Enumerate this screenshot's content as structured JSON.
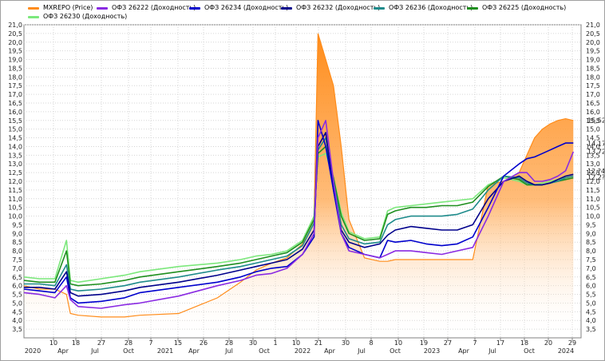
{
  "chart_data": {
    "type": "line",
    "ylim": [
      3.0,
      21.0
    ],
    "y_ticks": [
      "21,0",
      "20,5",
      "20,0",
      "19,5",
      "19,0",
      "18,5",
      "18,0",
      "17,5",
      "17,0",
      "16,5",
      "16,0",
      "15,5",
      "15,0",
      "14,5",
      "14,0",
      "13,5",
      "13,0",
      "12,5",
      "12,0",
      "11,5",
      "11,0",
      "10,5",
      "10,0",
      "9,5",
      "9,0",
      "8,5",
      "8,0",
      "7,5",
      "7,0",
      "6,5",
      "6,0",
      "5,5",
      "5,0",
      "4,5",
      "4,0",
      "3,5"
    ],
    "x_day_ticks": [
      "10",
      "18",
      "27",
      "28",
      "7",
      "15",
      "26",
      "28",
      "30",
      "1",
      "10",
      "21",
      "30",
      "8",
      "10",
      "19",
      "27",
      "7",
      "17",
      "18",
      "20",
      "29"
    ],
    "x_month_ticks": [
      "2020",
      "Apr",
      "Jul",
      "Oct",
      "2021",
      "Apr",
      "Jul",
      "Oct",
      "2022",
      "Apr",
      "Jul",
      "Oct",
      "2023",
      "Apr",
      "Jul",
      "Oct",
      "2024"
    ],
    "x": [
      0,
      20,
      40,
      55,
      60,
      70,
      100,
      130,
      150,
      200,
      250,
      280,
      300,
      320,
      340,
      360,
      375,
      380,
      390,
      400,
      410,
      420,
      440,
      460,
      470,
      480,
      500,
      520,
      540,
      560,
      580,
      600,
      620,
      640,
      650,
      660,
      670,
      680,
      690,
      700,
      710
    ],
    "grid": true,
    "last_value_labels": [
      "15,52",
      "14,17",
      "13,72",
      "12,?4",
      "12,2?"
    ],
    "series": [
      {
        "name": "MXREPO (Price)",
        "color": "#ff8c1a",
        "values": [
          6.0,
          5.8,
          5.8,
          5.5,
          4.4,
          4.3,
          4.2,
          4.2,
          4.3,
          4.4,
          5.3,
          6.2,
          6.9,
          7.3,
          7.6,
          8.4,
          10.0,
          20.5,
          19.0,
          17.5,
          14.0,
          9.8,
          7.6,
          7.4,
          7.4,
          7.5,
          7.5,
          7.5,
          7.5,
          7.5,
          7.5,
          11.8,
          12.0,
          12.5,
          13.5,
          14.5,
          15.0,
          15.3,
          15.5,
          15.6,
          15.5
        ]
      },
      {
        "name": "ОФЗ 26222 (Доходность)",
        "color": "#8a2be2",
        "values": [
          5.6,
          5.5,
          5.3,
          6.0,
          5.2,
          4.8,
          4.7,
          4.9,
          5.0,
          5.4,
          6.0,
          6.3,
          6.6,
          6.7,
          7.0,
          7.8,
          9.0,
          14.5,
          15.5,
          12.0,
          9.0,
          8.0,
          7.8,
          7.6,
          7.8,
          8.0,
          8.0,
          7.9,
          7.8,
          8.0,
          8.2,
          10.0,
          12.0,
          12.5,
          12.5,
          12.0,
          12.0,
          12.1,
          12.3,
          12.6,
          13.7
        ]
      },
      {
        "name": "ОФЗ 26234 (Доходность)",
        "color": "#0000cd",
        "values": [
          5.8,
          5.7,
          5.6,
          6.5,
          5.3,
          5.0,
          5.1,
          5.3,
          5.6,
          5.9,
          6.2,
          6.5,
          6.8,
          7.0,
          7.1,
          7.8,
          8.8,
          15.5,
          14.0,
          11.5,
          9.0,
          8.2,
          7.8,
          7.6,
          8.6,
          8.5,
          8.6,
          8.4,
          8.3,
          8.4,
          8.8,
          10.5,
          12.3,
          13.0,
          13.3,
          13.4,
          13.6,
          13.8,
          14.0,
          14.2,
          14.2
        ]
      },
      {
        "name": "ОФЗ 26232 (Доходность)",
        "color": "#00008b",
        "values": [
          5.9,
          5.9,
          5.8,
          6.8,
          5.6,
          5.4,
          5.5,
          5.7,
          5.9,
          6.2,
          6.6,
          6.9,
          7.1,
          7.3,
          7.5,
          8.1,
          9.2,
          14.0,
          14.8,
          11.5,
          9.2,
          8.5,
          8.2,
          8.4,
          8.9,
          9.2,
          9.4,
          9.3,
          9.2,
          9.2,
          9.5,
          11.0,
          12.0,
          12.3,
          12.0,
          11.8,
          11.8,
          11.9,
          12.1,
          12.3,
          12.4
        ]
      },
      {
        "name": "ОФЗ 26236 (Доходность)",
        "color": "#1e8b8b",
        "values": [
          6.1,
          6.1,
          6.0,
          7.2,
          5.8,
          5.7,
          5.8,
          6.0,
          6.2,
          6.5,
          6.9,
          7.1,
          7.3,
          7.5,
          7.7,
          8.3,
          9.6,
          13.8,
          14.5,
          12.0,
          9.5,
          8.7,
          8.4,
          8.5,
          9.5,
          9.8,
          10.0,
          10.0,
          10.0,
          10.1,
          10.4,
          11.5,
          12.3,
          12.2,
          11.9,
          11.8,
          11.8,
          11.9,
          12.0,
          12.2,
          12.3
        ]
      },
      {
        "name": "ОФЗ 26225 (Доходность)",
        "color": "#1f8f1f",
        "values": [
          6.3,
          6.2,
          6.2,
          8.0,
          6.1,
          6.0,
          6.1,
          6.3,
          6.5,
          6.8,
          7.1,
          7.3,
          7.5,
          7.7,
          7.9,
          8.5,
          9.8,
          13.6,
          14.0,
          12.2,
          10.0,
          9.0,
          8.6,
          8.7,
          10.1,
          10.3,
          10.5,
          10.5,
          10.6,
          10.6,
          10.8,
          11.7,
          12.3,
          12.1,
          11.8,
          11.8,
          11.8,
          11.9,
          12.0,
          12.1,
          12.2
        ]
      },
      {
        "name": "ОФЗ 26230 (Доходность)",
        "color": "#7ce87c",
        "values": [
          6.5,
          6.4,
          6.4,
          8.6,
          6.3,
          6.2,
          6.4,
          6.6,
          6.8,
          7.1,
          7.3,
          7.5,
          7.7,
          7.8,
          8.0,
          8.6,
          10.0,
          13.4,
          13.6,
          12.2,
          10.2,
          9.1,
          8.7,
          8.8,
          10.3,
          10.5,
          10.6,
          10.7,
          10.8,
          10.9,
          11.0,
          11.8,
          12.2,
          12.0,
          11.8,
          11.8,
          11.9,
          12.0,
          12.1,
          12.2,
          12.3
        ]
      }
    ]
  }
}
